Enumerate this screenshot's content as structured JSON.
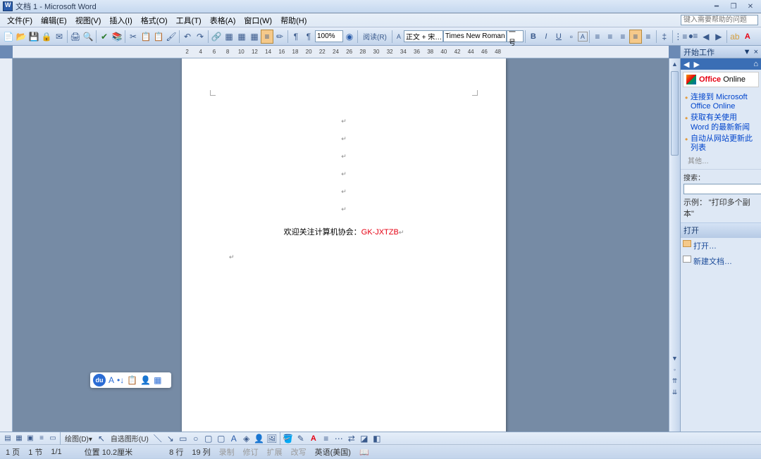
{
  "title": "文档 1 - Microsoft Word",
  "menu": [
    "文件(F)",
    "编辑(E)",
    "视图(V)",
    "插入(I)",
    "格式(O)",
    "工具(T)",
    "表格(A)",
    "窗口(W)",
    "帮助(H)"
  ],
  "help_placeholder": "键入需要帮助的问题",
  "toolbar": {
    "zoom": "100%",
    "style": "正文 + 宋…",
    "font": "Times New Roman",
    "size": "一号",
    "read_label": "阅读(R)"
  },
  "ruler_h": [
    "2",
    "4",
    "6",
    "8",
    "10",
    "12",
    "14",
    "16",
    "18",
    "20",
    "22",
    "24",
    "26",
    "28",
    "30",
    "32",
    "34",
    "36",
    "38",
    "40",
    "42",
    "44",
    "46",
    "48"
  ],
  "document": {
    "line_black": "欢迎关注计算机协会：",
    "line_red": "GK-JXTZB"
  },
  "task_pane": {
    "header": "开始工作",
    "office_label": "Office Online",
    "links": [
      "连接到 Microsoft Office Online",
      "获取有关使用 Word 的最新新闻",
      "自动从网站更新此列表"
    ],
    "other": "其他…",
    "search_label": "搜索：",
    "example_label": "示例：",
    "example_text": "\"打印多个副本\"",
    "open_header": "打开",
    "open_items": [
      "打开…",
      "新建文档…"
    ]
  },
  "statusbar": {
    "page": "1 页",
    "section": "1 节",
    "pages": "1/1",
    "position": "位置 10.2厘米",
    "line": "8 行",
    "col": "19 列",
    "modes": [
      "录制",
      "修订",
      "扩展",
      "改写"
    ],
    "lang": "英语(美国)"
  },
  "draw_label": "自选图形(U)"
}
